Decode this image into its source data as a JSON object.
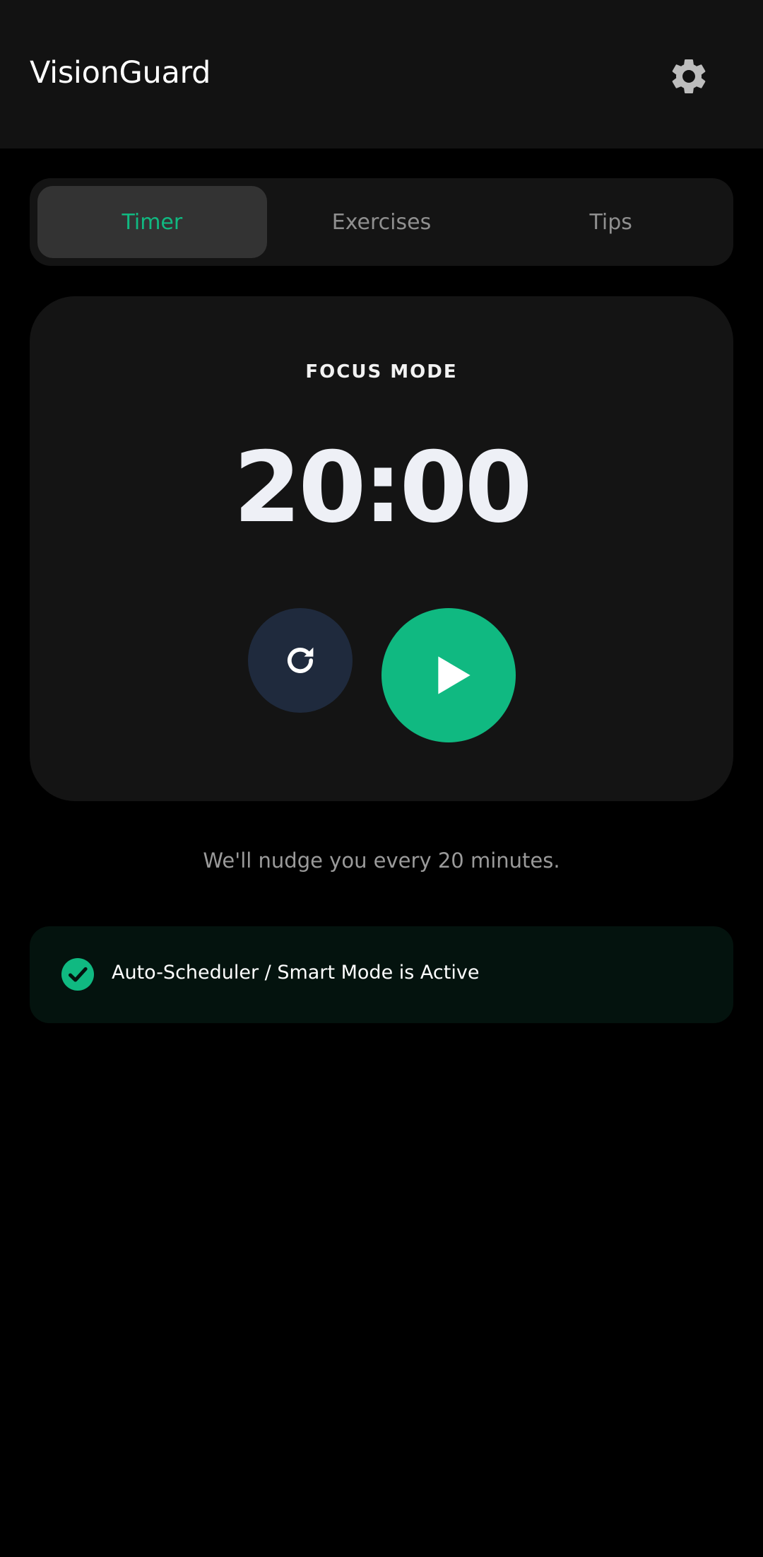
{
  "header": {
    "title": "VisionGuard",
    "settings_icon": "gear-icon"
  },
  "tabs": [
    {
      "label": "Timer",
      "active": true
    },
    {
      "label": "Exercises",
      "active": false
    },
    {
      "label": "Tips",
      "active": false
    }
  ],
  "timer": {
    "mode_label": "FOCUS MODE",
    "time": "20:00",
    "reset_icon": "refresh-icon",
    "play_icon": "play-icon"
  },
  "nudge_text": "We'll nudge you every 20 minutes.",
  "status": {
    "icon": "check-circle-icon",
    "text": "Auto-Scheduler / Smart Mode is Active"
  },
  "colors": {
    "accent": "#10b981",
    "background": "#000000",
    "surface": "#141414",
    "header": "#121212",
    "reset_button": "#1f2a3d",
    "status_banner": "#04130e"
  }
}
